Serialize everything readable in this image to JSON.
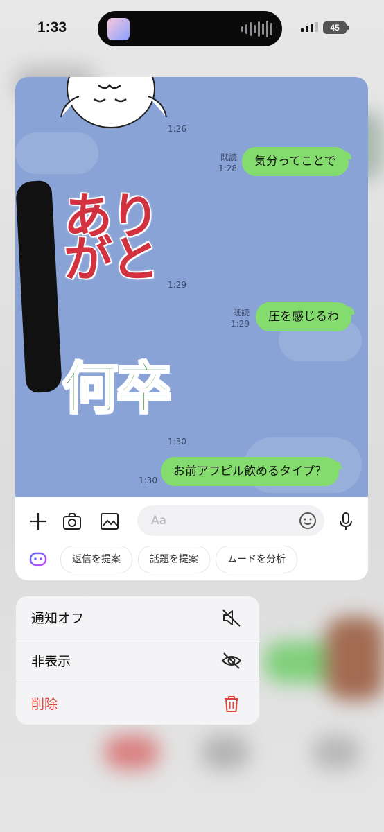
{
  "status_bar": {
    "time": "1:33",
    "battery": "45"
  },
  "chat": {
    "messages": [
      {
        "type": "sticker",
        "time": "1:26"
      },
      {
        "type": "sent",
        "read": "既読",
        "time": "1:28",
        "text": "気分ってことで"
      },
      {
        "type": "sticker",
        "text": "ありがと",
        "time": "1:29"
      },
      {
        "type": "sent",
        "read": "既読",
        "time": "1:29",
        "text": "圧を感じるわ"
      },
      {
        "type": "sticker",
        "text": "何卒",
        "time": "1:30"
      },
      {
        "type": "sent",
        "time": "1:30",
        "text": "お前アフピル飲めるタイプ？"
      }
    ],
    "sticker_arigato_line1": "あり",
    "sticker_arigato_line2": "がと",
    "sticker_nanisotsu": "何卒"
  },
  "input": {
    "placeholder": "Aa"
  },
  "suggestions": {
    "chips": [
      "返信を提案",
      "話題を提案",
      "ムードを分析"
    ]
  },
  "context_menu": {
    "items": [
      {
        "label": "通知オフ",
        "icon": "speaker-mute-icon"
      },
      {
        "label": "非表示",
        "icon": "eye-slash-icon"
      },
      {
        "label": "削除",
        "icon": "trash-icon",
        "color": "#e0443e"
      }
    ]
  },
  "colors": {
    "chat_background": "#8aa3d6",
    "bubble": "#85dc6e",
    "danger": "#e0443e"
  }
}
